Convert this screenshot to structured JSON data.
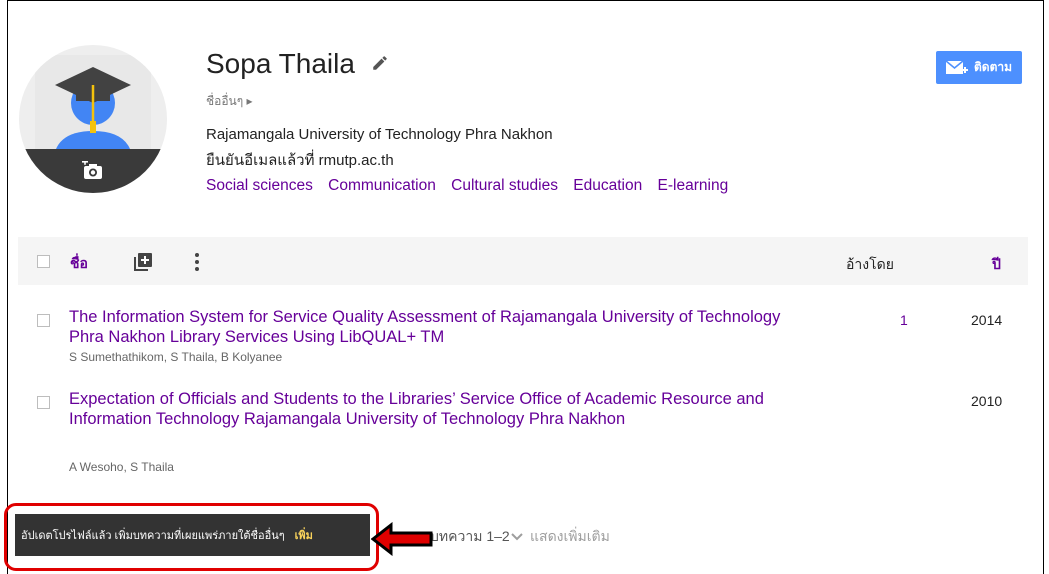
{
  "profile": {
    "name": "Sopa Thaila",
    "other_names": "ชื่ออื่นๆ ▸",
    "affiliation": "Rajamangala University of Technology Phra Nakhon",
    "verified_email": "ยืนยันอีเมลแล้วที่ rmutp.ac.th",
    "interests": [
      "Social sciences",
      "Communication",
      "Cultural studies",
      "Education",
      "E-learning"
    ],
    "follow_label": "ติดตาม"
  },
  "table": {
    "header": {
      "title": "ชื่อ",
      "cited_by": "อ้างโดย",
      "year": "ปี"
    },
    "rows": [
      {
        "title": "The Information System for Service Quality Assessment of Rajamangala University of Technology Phra Nakhon Library Services Using LibQUAL+ TM",
        "authors": "S Sumethathikom, S Thaila, B Kolyanee",
        "cited_by": "1",
        "year": "2014"
      },
      {
        "title": "Expectation of Officials and Students to the Libraries’ Service Office of Academic Resource and Information Technology Rajamangala University of Technology Phra Nakhon",
        "authors": "A Wesoho, S Thaila",
        "cited_by": "",
        "year": "2010"
      }
    ]
  },
  "footer": {
    "articles_count": "บทความ 1–2",
    "show_more": "แสดงเพิ่มเติม"
  },
  "toast": {
    "message": "อัปเดตโปรไฟล์แล้ว เพิ่มบทความที่เผยแพร่ภายใต้ชื่ออื่นๆ",
    "action": "เพิ่ม"
  },
  "colors": {
    "link": "#660099",
    "follow_button": "#4d90fe",
    "annotation": "#e00000",
    "toast_bg": "#333333"
  },
  "icons": [
    "graduation-avatar-icon",
    "add-photo-icon",
    "edit-pencil-icon",
    "follow-mail-icon",
    "add-column-icon",
    "more-vert-icon",
    "chevron-down-icon"
  ]
}
